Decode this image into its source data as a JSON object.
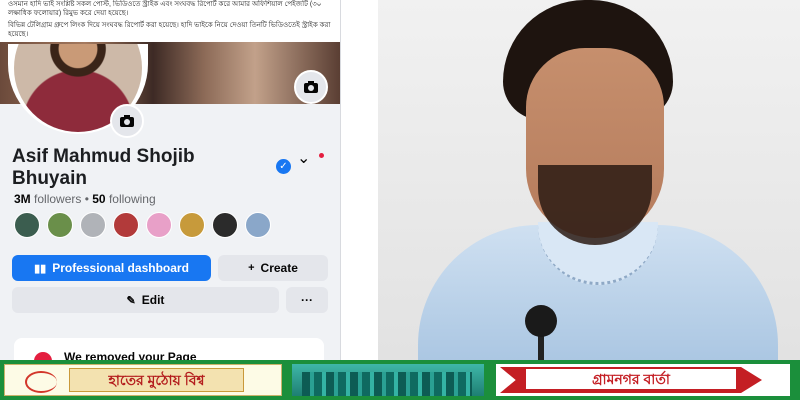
{
  "notice": {
    "line1": "ওসমান হাদি ভাই সংশ্লিষ্ট সকল পোস্ট, ভিডিওতে স্ট্রাইক এবং সংঘবদ্ধ রিপোর্ট করে আমার অফিশিয়াল পেইজটি (৩০ লক্ষাধিক ফলোয়ার) রিমুভ করে দেয়া হয়েছে।",
    "line2": "বিভিন্ন টেলিগ্রাম গ্রুপে লিংক দিয়ে সংঘবদ্ধ রিপোর্ট করা হয়েছে। হাদি ভাইকে নিয়ে দেওয়া তিনটি ভিডিওতেই স্ট্রাইক করা হয়েছে।"
  },
  "profile": {
    "name": "Asif Mahmud Shojib Bhuyain",
    "followers_count": "3M",
    "followers_label": "followers",
    "separator": " • ",
    "following_count": "50",
    "following_label": "following"
  },
  "friends": [
    "#3b5d4f",
    "#6a8f4a",
    "#b0b3b8",
    "#b23a3a",
    "#e8a0c8",
    "#c79a3b",
    "#2b2b2b",
    "#8aa7c9"
  ],
  "actions": {
    "professional_dashboard": "Professional dashboard",
    "create": "Create",
    "edit": "Edit",
    "more": "···"
  },
  "alert": {
    "text": "We removed your Page"
  },
  "banner": {
    "left_text": "হাতের মুঠোয় বিশ্ব",
    "right_text": "গ্রামনগর বার্তা"
  },
  "colors": {
    "facebook_blue": "#1877f2",
    "alert_red": "#e41e3f",
    "banner_green": "#1b8f3b",
    "banner_red": "#c41e24"
  },
  "icons": {
    "camera": "camera-icon",
    "verified": "verified-badge-icon",
    "chevron": "chevron-down-icon",
    "dashboard": "bar-chart-icon",
    "create": "plus-icon",
    "edit": "pencil-icon"
  }
}
